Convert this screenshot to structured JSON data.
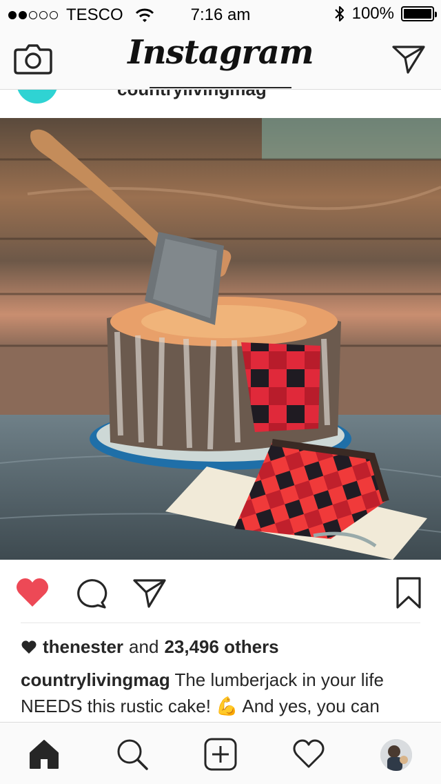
{
  "status_bar": {
    "carrier": "TESCO",
    "time": "7:16 am",
    "battery": "100%",
    "icons": [
      "signal-dots",
      "wifi-icon",
      "bluetooth-icon",
      "battery-icon"
    ]
  },
  "header": {
    "logo": "Instagram",
    "left_icon": "camera-icon",
    "right_icon": "direct-message-icon"
  },
  "post": {
    "username": "countrylivingmag",
    "liked_by": "thenester",
    "likes_connector": "and",
    "likes_others": "23,496 others",
    "caption_text": "The lumberjack in your life NEEDS this rustic cake! 💪 And yes, you can make it yourself...",
    "image_alt": "lumberjack-cake-photo",
    "actions": [
      "like-icon",
      "comment-icon",
      "share-icon",
      "bookmark-icon"
    ],
    "liked": true
  },
  "tabbar": {
    "items": [
      "home-icon",
      "search-icon",
      "add-icon",
      "activity-icon",
      "profile-avatar"
    ],
    "active": "home-icon"
  },
  "colors": {
    "like": "#ed4956",
    "text": "#262626",
    "accent_avatar": "#2fd3d3"
  }
}
